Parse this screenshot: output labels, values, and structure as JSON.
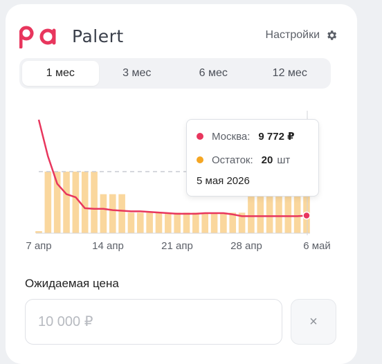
{
  "app": {
    "brand": "Palert",
    "logo_text": "pa"
  },
  "header": {
    "settings_label": "Настройки"
  },
  "tabs": [
    {
      "label": "1 мес",
      "active": true
    },
    {
      "label": "3 мес",
      "active": false
    },
    {
      "label": "6 мес",
      "active": false
    },
    {
      "label": "12 мес",
      "active": false
    }
  ],
  "colors": {
    "accent": "#e8365d",
    "stock": "#fad79d",
    "stock_dot": "#f5a623"
  },
  "tooltip": {
    "city_label": "Москва:",
    "price": "9 772 ₽",
    "stock_label": "Остаток:",
    "stock_value": "20",
    "stock_unit": "шт",
    "date": "5 мая 2026"
  },
  "chart_data": {
    "type": "line",
    "x_tick_labels": [
      "7 апр",
      "14 апр",
      "21 апр",
      "28 апр",
      "6 май"
    ],
    "series": [
      {
        "values": [
          27000,
          21000,
          16500,
          14800,
          14300,
          12500,
          12400,
          12400,
          12200,
          12100,
          12000,
          12000,
          11900,
          11800,
          11700,
          11600,
          11600,
          11600,
          11700,
          11700,
          11700,
          11500,
          11200,
          11200,
          11200,
          11200,
          11200,
          11200,
          11200,
          11300
        ]
      },
      {
        "type": "bar",
        "values": [
          1,
          30,
          30,
          30,
          30,
          30,
          30,
          19,
          19,
          19,
          10,
          10,
          10,
          10,
          10,
          10,
          10,
          10,
          10,
          10,
          10,
          10,
          10,
          20,
          20,
          20,
          20,
          20,
          20,
          20
        ]
      }
    ],
    "reference_line": true,
    "selected_point": {
      "price": 9772,
      "stock": 20,
      "date": "5 мая 2026"
    }
  },
  "form": {
    "expected_price_label": "Ожидаемая цена",
    "price_value": "",
    "price_placeholder": "10 000 ₽",
    "clear_label": "×"
  }
}
